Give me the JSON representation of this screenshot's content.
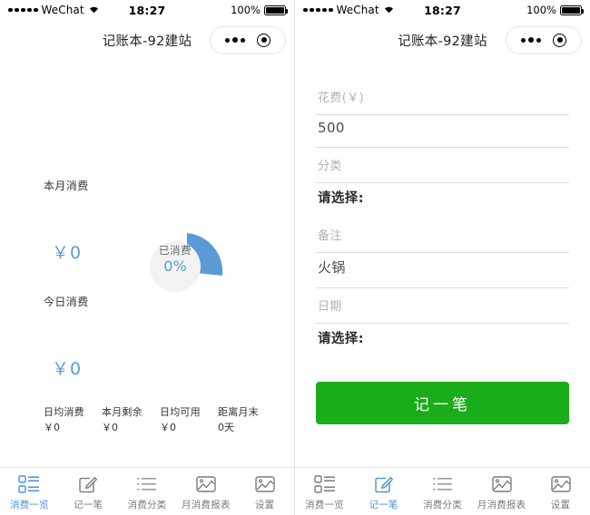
{
  "status_bar": {
    "carrier": "WeChat",
    "signal_dots": 5,
    "time": "18:27",
    "battery_percent": "100%"
  },
  "nav": {
    "title": "记账本-92建站",
    "capsule_more_icon": "more-dots-icon",
    "capsule_target_icon": "target-circle-icon"
  },
  "overview": {
    "month_label": "本月消费",
    "month_amount": "￥0",
    "today_label": "今日消费",
    "today_amount": "￥0",
    "donut": {
      "caption": "已消费",
      "percent_text": "0%",
      "wedge_color": "#5b9bd5",
      "hole_color": "#f2f2f2"
    },
    "stats": [
      {
        "name": "日均消费",
        "value": "￥0"
      },
      {
        "name": "本月剩余",
        "value": "￥0"
      },
      {
        "name": "日均可用",
        "value": "￥0"
      },
      {
        "name": "距离月末",
        "value": "0天"
      }
    ]
  },
  "form": {
    "amount_label": "花费(￥)",
    "amount_value": "500",
    "category_label": "分类",
    "category_value": "请选择:",
    "note_label": "备注",
    "note_value": "火锅",
    "date_label": "日期",
    "date_value": "请选择:",
    "submit_label": "记一笔",
    "submit_color": "#1aad19"
  },
  "tabbar": {
    "accent_color": "#4a90d9",
    "items": [
      {
        "label": "消费一览",
        "icon": "list-icon"
      },
      {
        "label": "记一笔",
        "icon": "edit-square-icon"
      },
      {
        "label": "消费分类",
        "icon": "bullet-list-icon"
      },
      {
        "label": "月消费报表",
        "icon": "chart-image-icon"
      },
      {
        "label": "设置",
        "icon": "chart-image-icon"
      }
    ],
    "left_active_index": 0,
    "right_active_index": 1
  }
}
